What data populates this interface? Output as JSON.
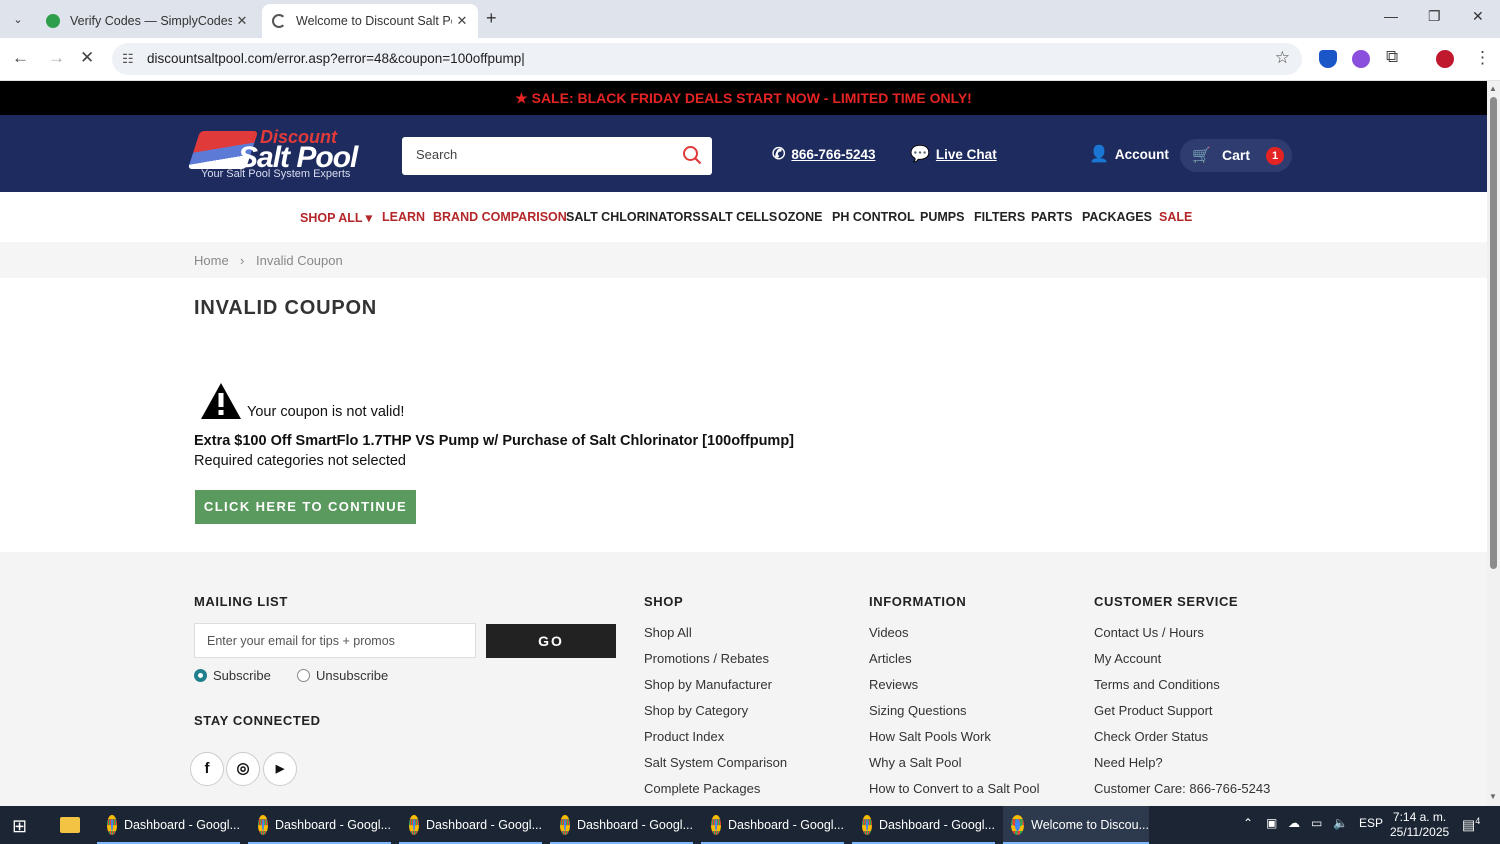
{
  "browser": {
    "tabs": [
      {
        "title": "Verify Codes — SimplyCodes",
        "active": false
      },
      {
        "title": "Welcome to Discount Salt Pool",
        "active": true
      }
    ],
    "url": "discountsaltpool.com/error.asp?error=48&coupon=100offpump|"
  },
  "promo": {
    "text": "SALE: BLACK FRIDAY DEALS START NOW - LIMITED TIME ONLY!"
  },
  "header": {
    "logo_line1": "Discount",
    "logo_line2": "Salt Pool",
    "logo_tagline": "Your Salt Pool System Experts",
    "search_placeholder": "Search",
    "phone": "866-766-5243",
    "live_chat": "Live Chat",
    "account": "Account",
    "cart_label": "Cart",
    "cart_count": "1"
  },
  "nav": {
    "items": [
      "SHOP ALL ▾",
      "LEARN",
      "BRAND COMPARISON",
      "SALT CHLORINATORS",
      "SALT CELLS",
      "OZONE",
      "PH CONTROL",
      "PUMPS",
      "FILTERS",
      "PARTS",
      "PACKAGES",
      "SALE"
    ]
  },
  "breadcrumb": {
    "home": "Home",
    "sep": "›",
    "current": "Invalid Coupon"
  },
  "main": {
    "title": "INVALID COUPON",
    "message": "Your coupon is not valid!",
    "coupon_desc": "Extra $100 Off SmartFlo 1.7THP VS Pump w/ Purchase of Salt Chlorinator [100offpump]",
    "reason": "Required categories not selected",
    "cta": "CLICK HERE TO CONTINUE"
  },
  "footer": {
    "mailing_title": "MAILING LIST",
    "email_placeholder": "Enter your email for tips + promos",
    "go": "GO",
    "subscribe": "Subscribe",
    "unsubscribe": "Unsubscribe",
    "stay_connected": "STAY CONNECTED",
    "shop_title": "SHOP",
    "shop_links": [
      "Shop All",
      "Promotions / Rebates",
      "Shop by Manufacturer",
      "Shop by Category",
      "Product Index",
      "Salt System Comparison",
      "Complete Packages"
    ],
    "info_title": "INFORMATION",
    "info_links": [
      "Videos",
      "Articles",
      "Reviews",
      "Sizing Questions",
      "How Salt Pools Work",
      "Why a Salt Pool",
      "How to Convert to a Salt Pool"
    ],
    "cs_title": "CUSTOMER SERVICE",
    "cs_links": [
      "Contact Us / Hours",
      "My Account",
      "Terms and Conditions",
      "Get Product Support",
      "Check Order Status",
      "Need Help?",
      "Customer Care: 866-766-5243"
    ]
  },
  "taskbar": {
    "apps": [
      "Dashboard - Googl...",
      "Dashboard - Googl...",
      "Dashboard - Googl...",
      "Dashboard - Googl...",
      "Dashboard - Googl...",
      "Dashboard - Googl...",
      "Welcome to Discou..."
    ],
    "lang": "ESP",
    "time": "7:14 a. m.",
    "date": "25/11/2025",
    "notifications": "4"
  },
  "colors": {
    "brand_navy": "#1e2b5e",
    "sale_red": "#e42323",
    "cta_green": "#5a9a5f"
  }
}
